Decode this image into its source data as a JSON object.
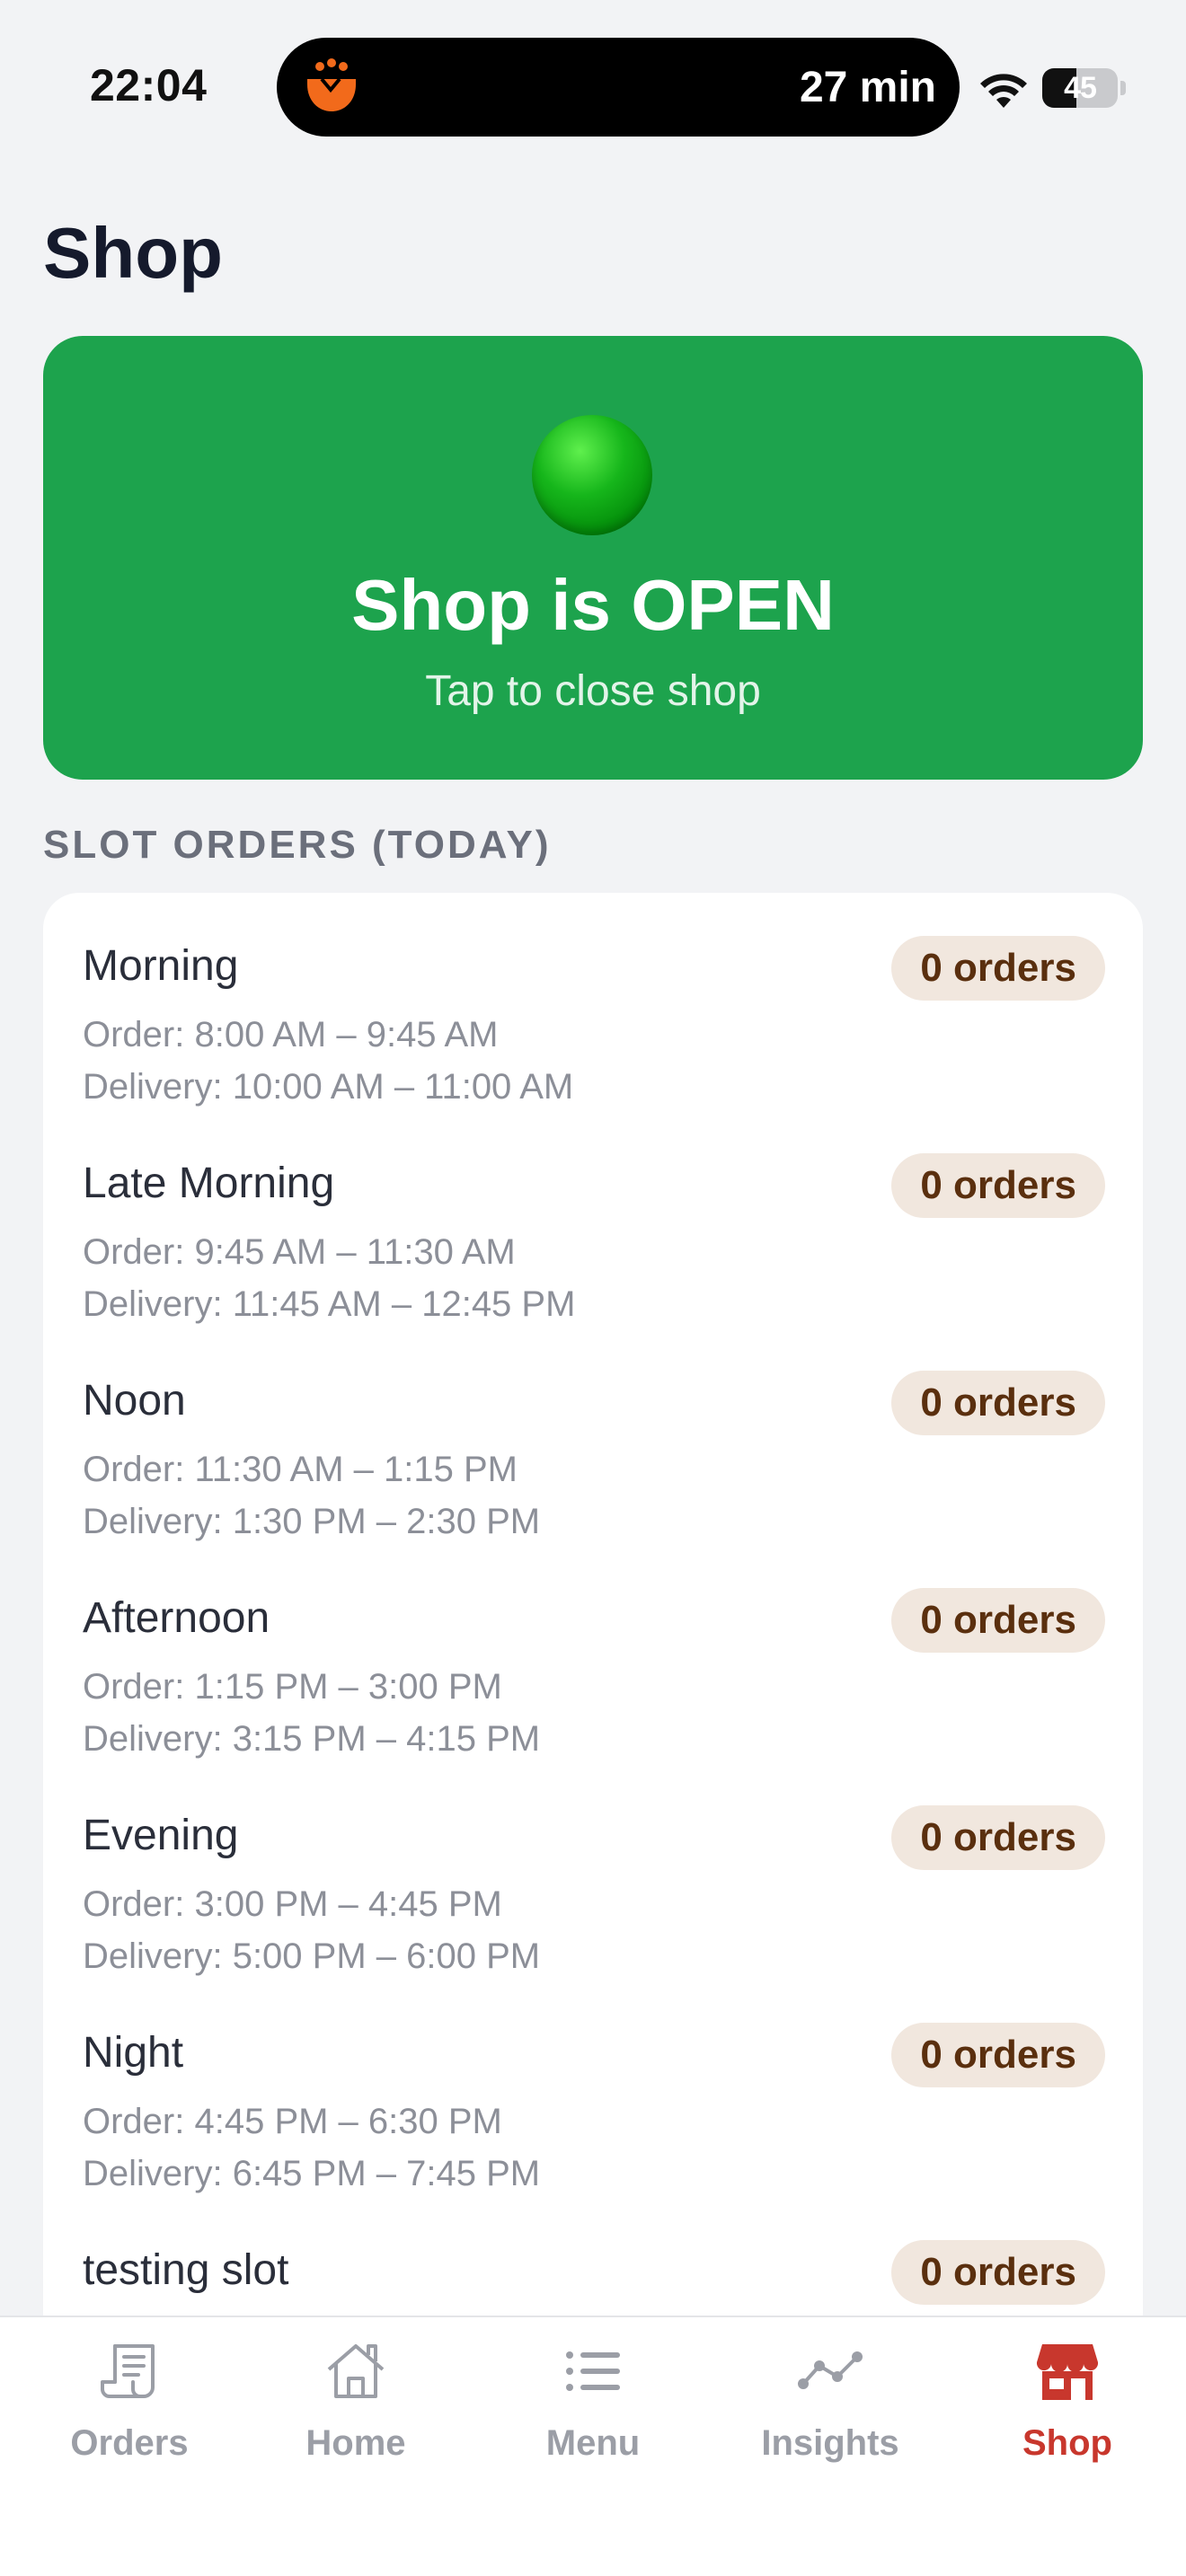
{
  "status_bar": {
    "time": "22:04",
    "activity_timer": "27 min",
    "battery_percent": 45,
    "battery_label": "45",
    "app_icon": "cooking-pot-icon",
    "wifi_icon": "wifi-icon",
    "battery_icon": "battery-icon"
  },
  "page": {
    "title": "Shop"
  },
  "shop_status": {
    "title": "Shop is OPEN",
    "subtitle": "Tap to close shop",
    "is_open": true,
    "color": "#1da34d",
    "indicator_icon": "green-circle-icon"
  },
  "slots_section": {
    "header": "SLOT ORDERS (TODAY)",
    "items": [
      {
        "name": "Morning",
        "order": "Order: 8:00 AM – 9:45 AM",
        "delivery": "Delivery: 10:00 AM – 11:00 AM",
        "badge": "0 orders"
      },
      {
        "name": "Late Morning",
        "order": "Order: 9:45 AM – 11:30 AM",
        "delivery": "Delivery: 11:45 AM – 12:45 PM",
        "badge": "0 orders"
      },
      {
        "name": "Noon",
        "order": "Order: 11:30 AM – 1:15 PM",
        "delivery": "Delivery: 1:30 PM – 2:30 PM",
        "badge": "0 orders"
      },
      {
        "name": "Afternoon",
        "order": "Order: 1:15 PM – 3:00 PM",
        "delivery": "Delivery: 3:15 PM – 4:15 PM",
        "badge": "0 orders"
      },
      {
        "name": "Evening",
        "order": "Order: 3:00 PM – 4:45 PM",
        "delivery": "Delivery: 5:00 PM – 6:00 PM",
        "badge": "0 orders"
      },
      {
        "name": "Night",
        "order": "Order: 4:45 PM – 6:30 PM",
        "delivery": "Delivery: 6:45 PM – 7:45 PM",
        "badge": "0 orders"
      },
      {
        "name": "testing slot",
        "order": "",
        "delivery": "",
        "badge": "0 orders"
      }
    ]
  },
  "tab_bar": {
    "active_color": "#c8372d",
    "inactive_color": "#9b9ea6",
    "tabs": [
      {
        "label": "Orders",
        "icon": "receipt-icon",
        "active": false
      },
      {
        "label": "Home",
        "icon": "home-icon",
        "active": false
      },
      {
        "label": "Menu",
        "icon": "list-icon",
        "active": false
      },
      {
        "label": "Insights",
        "icon": "trend-line-icon",
        "active": false
      },
      {
        "label": "Shop",
        "icon": "storefront-icon",
        "active": true
      }
    ]
  }
}
